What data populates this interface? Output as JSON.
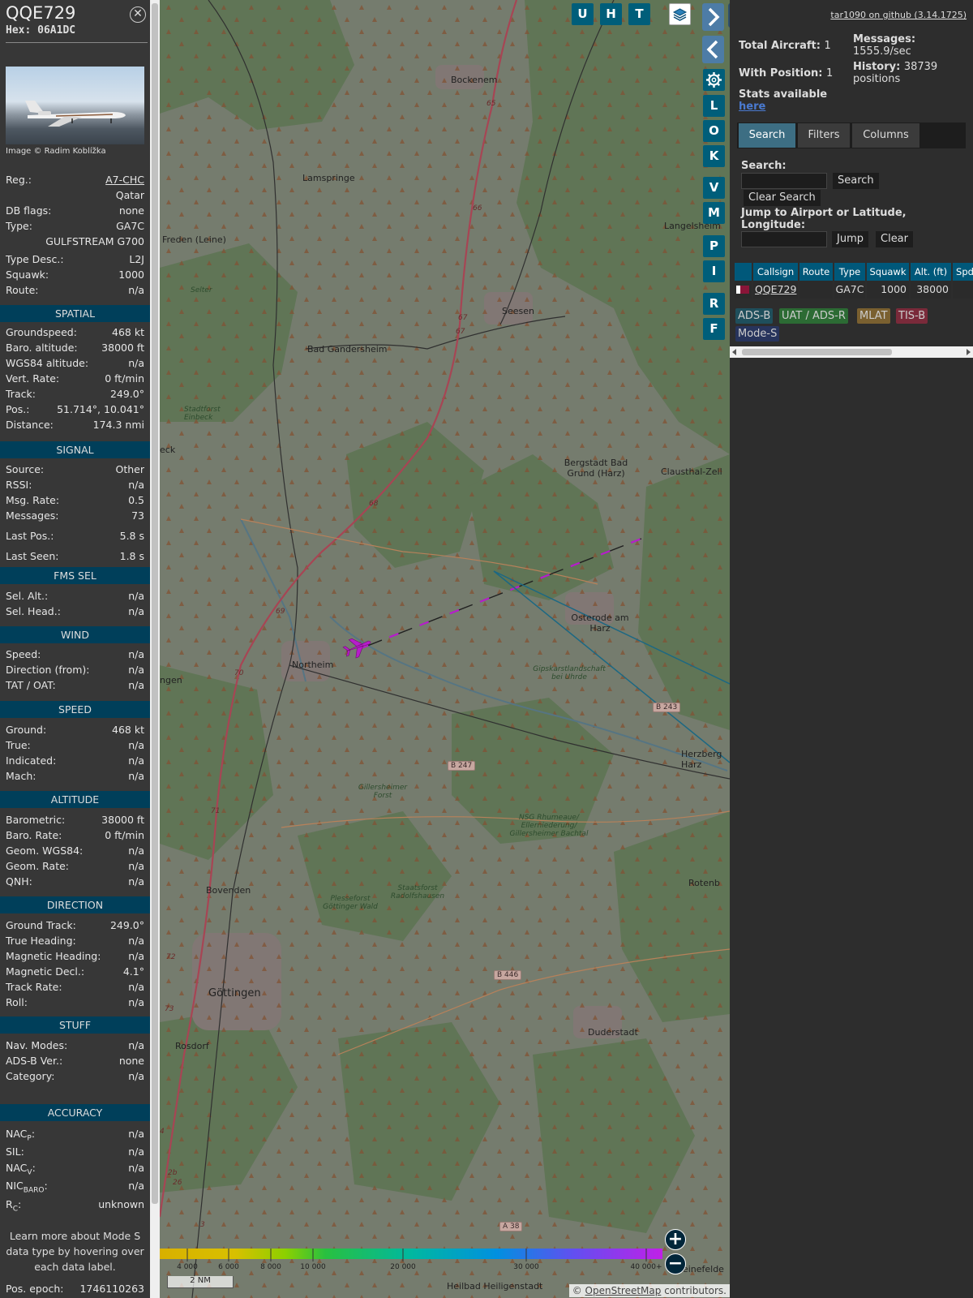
{
  "aircraft": {
    "callsign": "QQE729",
    "hex_label": "Hex: 06A1DC",
    "image_credit": "Image © Radim Koblížka"
  },
  "info": {
    "reg_label": "Reg.:",
    "reg": "A7-CHC",
    "country": "Qatar",
    "dbflags_label": "DB flags:",
    "dbflags": "none",
    "type_label": "Type:",
    "type": "GA7C",
    "type_name": "GULFSTREAM G700",
    "typedesc_label": "Type Desc.:",
    "typedesc": "L2J",
    "squawk_label": "Squawk:",
    "squawk": "1000",
    "route_label": "Route:",
    "route": "n/a"
  },
  "sections": {
    "spatial": "SPATIAL",
    "signal": "SIGNAL",
    "fms": "FMS SEL",
    "wind": "WIND",
    "speed": "SPEED",
    "altitude": "ALTITUDE",
    "direction": "DIRECTION",
    "stuff": "STUFF",
    "accuracy": "ACCURACY"
  },
  "spatial": [
    {
      "k": "Groundspeed:",
      "v": "468 kt"
    },
    {
      "k": "Baro. altitude:",
      "v": "38000 ft"
    },
    {
      "k": "WGS84 altitude:",
      "v": "n/a"
    },
    {
      "k": "Vert. Rate:",
      "v": "0 ft/min"
    },
    {
      "k": "Track:",
      "v": "249.0°"
    },
    {
      "k": "Pos.:",
      "v": "51.714°, 10.041°"
    },
    {
      "k": "Distance:",
      "v": "174.3 nmi"
    }
  ],
  "signal": [
    {
      "k": "Source:",
      "v": "Other"
    },
    {
      "k": "RSSI:",
      "v": "n/a"
    },
    {
      "k": "Msg. Rate:",
      "v": "0.5"
    },
    {
      "k": "Messages:",
      "v": "73"
    },
    {
      "k": "Last Pos.:",
      "v": "5.8 s"
    },
    {
      "k": "Last Seen:",
      "v": "1.8 s"
    }
  ],
  "fms": [
    {
      "k": "Sel. Alt.:",
      "v": "n/a"
    },
    {
      "k": "Sel. Head.:",
      "v": "n/a"
    }
  ],
  "wind": [
    {
      "k": "Speed:",
      "v": "n/a"
    },
    {
      "k": "Direction (from):",
      "v": "n/a"
    },
    {
      "k": "TAT / OAT:",
      "v": "n/a"
    }
  ],
  "speed": [
    {
      "k": "Ground:",
      "v": "468 kt"
    },
    {
      "k": "True:",
      "v": "n/a"
    },
    {
      "k": "Indicated:",
      "v": "n/a"
    },
    {
      "k": "Mach:",
      "v": "n/a"
    }
  ],
  "altitude": [
    {
      "k": "Barometric:",
      "v": "38000 ft"
    },
    {
      "k": "Baro. Rate:",
      "v": "0 ft/min"
    },
    {
      "k": "Geom. WGS84:",
      "v": "n/a"
    },
    {
      "k": "Geom. Rate:",
      "v": "n/a"
    },
    {
      "k": "QNH:",
      "v": "n/a"
    }
  ],
  "direction": [
    {
      "k": "Ground Track:",
      "v": "249.0°"
    },
    {
      "k": "True Heading:",
      "v": "n/a"
    },
    {
      "k": "Magnetic Heading:",
      "v": "n/a"
    },
    {
      "k": "Magnetic Decl.:",
      "v": "4.1°"
    },
    {
      "k": "Track Rate:",
      "v": "n/a"
    },
    {
      "k": "Roll:",
      "v": "n/a"
    }
  ],
  "stuff": [
    {
      "k": "Nav. Modes:",
      "v": "n/a"
    },
    {
      "k": "ADS-B Ver.:",
      "v": "none"
    },
    {
      "k": "Category:",
      "v": "n/a"
    }
  ],
  "accuracy": {
    "nacp_main": "NAC",
    "nacp_sub": "P",
    "nacp": "n/a",
    "sil_label": "SIL:",
    "sil": "n/a",
    "nacv_main": "NAC",
    "nacv_sub": "V",
    "nacv": "n/a",
    "nic_main": "NIC",
    "nic_sub": "BARO",
    "nic": "n/a",
    "rc_main": "R",
    "rc_sub": "C",
    "rc": "unknown"
  },
  "note": "Learn more about Mode S data type by hovering over each data label.",
  "epoch_label": "Pos. epoch:",
  "epoch": "1746110263",
  "map_buttons": {
    "u": "U",
    "h": "H",
    "t": "T",
    "l": "L",
    "o": "O",
    "k": "K",
    "v": "V",
    "m": "M",
    "p": "P",
    "i": "I",
    "r": "R",
    "f": "F"
  },
  "places": {
    "bockenem": "Bockenem",
    "lamspringe": "Lamspringe",
    "freden": "Freden (Leine)",
    "seesen": "Seesen",
    "bad_gandersheim": "Bad Gandersheim",
    "stadtforst_einbeck": "Stadtforst Einbeck",
    "eck": "eck",
    "bergstadt": "Bergstadt Bad Grund (Harz)",
    "clausthal": "Clausthal-Zell",
    "langelsheim": "Langelsheim",
    "osterode": "Osterode am Harz",
    "northeim": "Northeim",
    "ngen": "ngen",
    "gipskarst": "Gipskarstlandschaft bei Uhrde",
    "herzberg": "Herzberg Harz",
    "gillersheimer_forst": "Gillersheimer Forst",
    "nsg": "NSG Rhumeaue/ Ellerniederung/ Gillersheimer Bachtal",
    "rotenberg": "Rotenb",
    "bovenden": "Bovenden",
    "plesseforst": "Plesseforst Göttinger Wald",
    "staatsforst": "Staatsforst Radolfshausen",
    "goettingen": "Göttingen",
    "rosdorf": "Rosdorf",
    "duderstadt": "Duderstadt",
    "heilbad": "Heilbad Heiligenstadt",
    "leinefelde": "Leinefelde",
    "selter": "Selter"
  },
  "roads": {
    "b243": "B 243",
    "b247": "B 247",
    "b446": "B 446",
    "a38": "A 38",
    "n65": "65",
    "n66": "66",
    "n67a": "67",
    "n67b": "67",
    "n68": "68",
    "n69": "69",
    "n70": "70",
    "n71": "71",
    "n72": "72",
    "n73": "73",
    "n2b": "2b",
    "n26": "26",
    "n3": "3",
    "n4": "4"
  },
  "colorbar": {
    "ticks": [
      "4 000",
      "6 000",
      "8 000",
      "10 000",
      "20 000",
      "30 000",
      "40 000+"
    ]
  },
  "scale_label": "2 NM",
  "attribution_prefix": "© ",
  "attribution_link": "OpenStreetMap",
  "attribution_suffix": " contributors.",
  "sidebar": {
    "version": "tar1090 on github (3.14.1725)",
    "total_label": "Total Aircraft:",
    "total": "1",
    "messages_label": "Messages:",
    "messages": "1555.9/sec",
    "withpos_label": "With Position:",
    "withpos": "1",
    "history_label": "History:",
    "history_a": "38739",
    "history_b": "positions",
    "stats_label": "Stats available",
    "stats_link": "here",
    "tabs": [
      "Search",
      "Filters",
      "Columns"
    ],
    "search_label": "Search:",
    "search_button": "Search",
    "clear_search": "Clear Search",
    "jump_label": "Jump to Airport or Latitude, Longitude:",
    "jump_button": "Jump",
    "clear_button": "Clear"
  },
  "table": {
    "headers": [
      "Callsign",
      "Route",
      "Type",
      "Squawk",
      "Alt. (ft)",
      "Spd"
    ],
    "row": {
      "callsign": "QQE729",
      "route": "",
      "type": "GA7C",
      "squawk": "1000",
      "alt": "38000"
    }
  },
  "sources": [
    "ADS-B",
    "UAT / ADS-R",
    "MLAT",
    "TIS-B",
    "Mode-S"
  ],
  "colors": {
    "aircraft": "#c21fd8",
    "section_header": "#003f5a",
    "button": "#005e7a",
    "adsb": "#1f4f5c",
    "uat": "#2c6b34",
    "mlat": "#7a6030",
    "tisb": "#7a2a3a",
    "modes": "#27345c"
  }
}
